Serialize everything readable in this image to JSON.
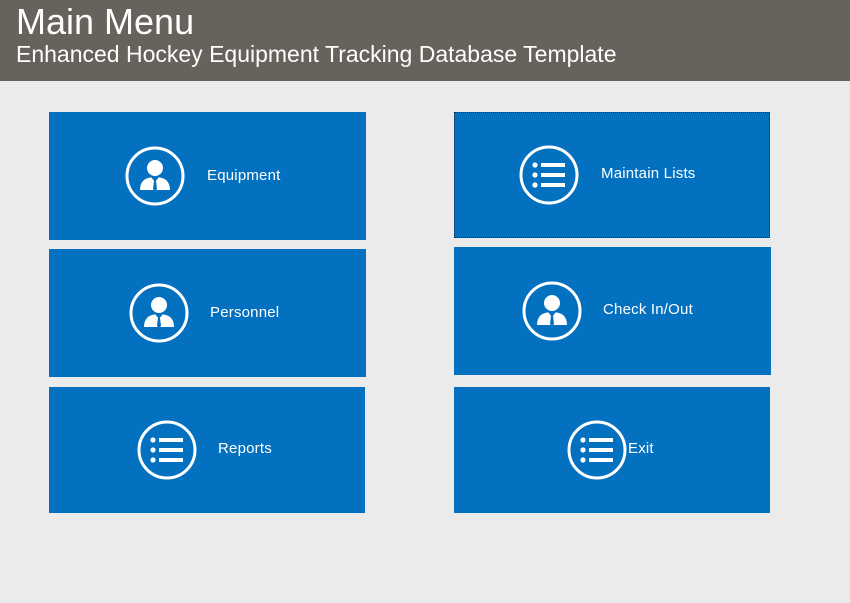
{
  "header": {
    "title": "Main Menu",
    "subtitle": "Enhanced Hockey Equipment Tracking Database Template",
    "background": "#67625c"
  },
  "colors": {
    "tile": "#0370c0",
    "page": "#ebebeb",
    "text": "#ffffff"
  },
  "tiles": [
    {
      "label": "Equipment",
      "icon": "person-icon"
    },
    {
      "label": "Maintain Lists",
      "icon": "list-icon"
    },
    {
      "label": "Personnel",
      "icon": "person-icon"
    },
    {
      "label": "Check In/Out",
      "icon": "person-icon"
    },
    {
      "label": "Reports",
      "icon": "list-icon"
    },
    {
      "label": "Exit",
      "icon": "list-icon"
    }
  ]
}
